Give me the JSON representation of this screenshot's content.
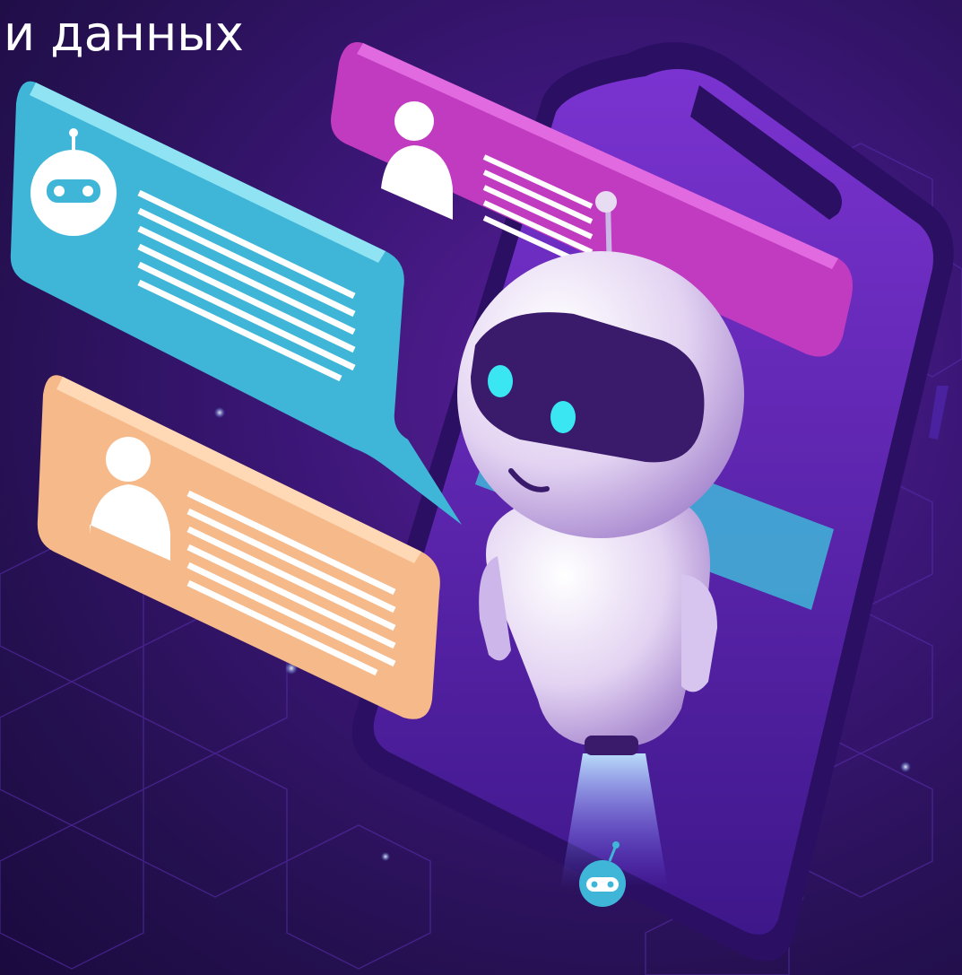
{
  "headline": "и данных",
  "colors": {
    "background_dark": "#1a0a3e",
    "background_mid": "#3a1675",
    "phone_frame": "#2a0f63",
    "phone_screen": "#6a2dc4",
    "bubble_bot": "#3fb6d8",
    "bubble_user_top": "#c13bc0",
    "bubble_user_bottom": "#f5b98a",
    "robot_body": "#e8dcf2",
    "robot_visor": "#3a1a6b",
    "robot_eyes": "#39e6f2"
  },
  "icons": [
    "bot-avatar-icon",
    "user-avatar-icon",
    "message-lines-icon",
    "robot-mascot",
    "smartphone"
  ]
}
